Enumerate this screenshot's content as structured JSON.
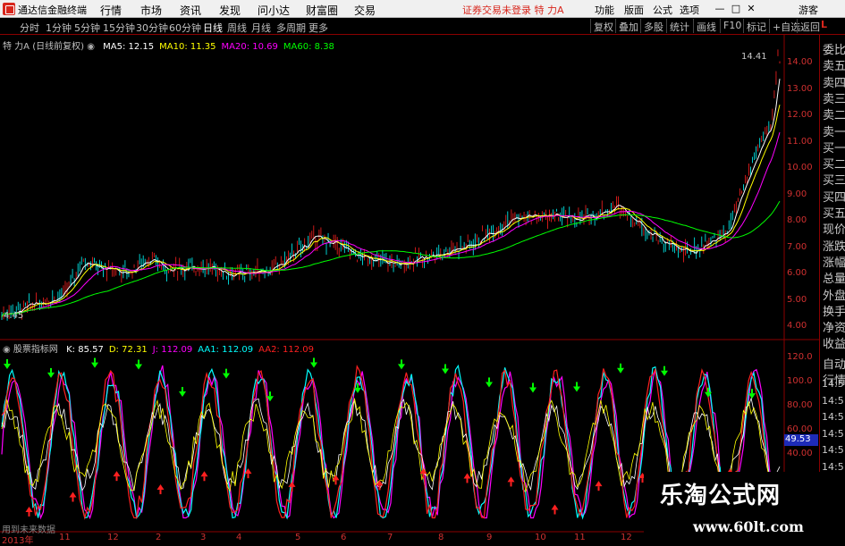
{
  "titlebar": {
    "app_title": "通达信金融终端",
    "menus": [
      "行情",
      "市场",
      "资讯",
      "发现",
      "问小达",
      "财富圈",
      "交易"
    ],
    "status_message": "证券交易未登录  特 力A",
    "right_menus": [
      "功能",
      "版面",
      "公式",
      "选项"
    ],
    "guest_label": "游客"
  },
  "tabbar": {
    "periods": [
      "分时",
      "1分钟",
      "5分钟",
      "15分钟",
      "30分钟",
      "60分钟",
      "日线",
      "周线",
      "月线",
      "多周期",
      "更多"
    ],
    "active_period": "日线",
    "tools": [
      "复权",
      "叠加",
      "多股",
      "统计",
      "画线",
      "F10",
      "标记",
      "+自选",
      "返回"
    ]
  },
  "main_chart": {
    "stock_name": "特 力A",
    "adjust_note": "(日线前复权)",
    "ma_labels": [
      {
        "text": "MA5: 12.15",
        "color": "#ffffff"
      },
      {
        "text": "MA10: 11.35",
        "color": "#ffff00"
      },
      {
        "text": "MA20: 10.69",
        "color": "#ff00ff"
      },
      {
        "text": "MA60: 8.38",
        "color": "#00ff00"
      }
    ],
    "high_marker": "14.41",
    "low_marker": "4.45",
    "y_ticks": [
      "14.00",
      "13.00",
      "12.00",
      "11.00",
      "10.00",
      "9.00",
      "8.00",
      "7.00",
      "6.00",
      "5.00",
      "4.00"
    ]
  },
  "indicator": {
    "name": "股票指标网",
    "values": [
      {
        "text": "K: 85.57",
        "color": "#ffffff"
      },
      {
        "text": "D: 72.31",
        "color": "#ffff00"
      },
      {
        "text": "J: 112.09",
        "color": "#ff00ff"
      },
      {
        "text": "AA1: 112.09",
        "color": "#00ffff"
      },
      {
        "text": "AA2: 112.09",
        "color": "#ff2020"
      }
    ],
    "y_ticks": [
      "120.0",
      "100.0",
      "80.00",
      "60.00",
      "40.00"
    ],
    "current_value": "49.53",
    "footer_note": "用到未来数据"
  },
  "x_axis": {
    "labels": [
      "2013年",
      "11",
      "12",
      "2",
      "3",
      "4",
      "5",
      "6",
      "7",
      "8",
      "9",
      "10",
      "11",
      "12"
    ]
  },
  "right_panel": {
    "badge": "L",
    "items": [
      "委比",
      "卖五",
      "卖四",
      "卖三",
      "卖二",
      "卖一",
      "买一",
      "买二",
      "买三",
      "买四",
      "买五",
      "现价",
      "涨跌",
      "涨幅",
      "总量",
      "外盘",
      "换手",
      "净资",
      "收益",
      "自动",
      "行情"
    ],
    "times": [
      "14:5",
      "14:5",
      "14:5",
      "14:5",
      "14:5",
      "14:5",
      "14:5",
      "14:5"
    ]
  },
  "watermark": {
    "title": "乐淘公式网",
    "url": "www.60lt.com"
  },
  "colors": {
    "up": "#ff2020",
    "down": "#00ffff",
    "ma5": "#ffffff",
    "ma10": "#ffff00",
    "ma20": "#ff00ff",
    "ma60": "#00ff00",
    "axis": "#d03030",
    "buy_arrow": "#ff2020",
    "sell_arrow": "#00ff00"
  },
  "icons": [
    "app-logo-icon",
    "close-icon",
    "minimize-icon",
    "maximize-icon",
    "restore-icon",
    "gear-icon"
  ]
}
